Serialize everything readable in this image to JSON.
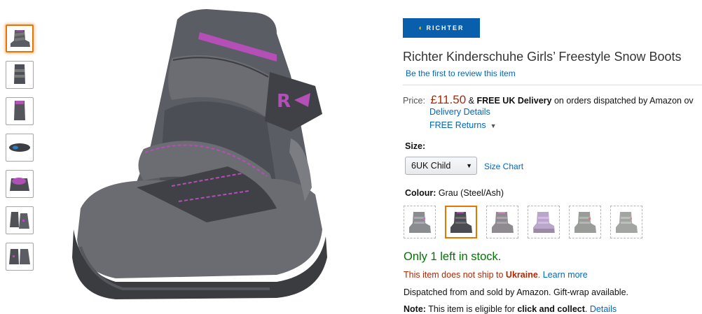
{
  "brand": {
    "logo_text": "RICHTER"
  },
  "product": {
    "title": "Richter Kinderschuhe Girls’ Freestyle Snow Boots",
    "review_link": "Be the first to review this item"
  },
  "pricing": {
    "label": "Price:",
    "price": "£11.50",
    "amp": "&",
    "free_delivery": "FREE UK Delivery",
    "delivery_suffix": "on orders dispatched by Amazon ov",
    "delivery_details_link": "Delivery Details",
    "free_returns_link": "FREE Returns"
  },
  "size": {
    "label": "Size:",
    "selected": "6UK Child",
    "chart_link": "Size Chart"
  },
  "colour": {
    "label": "Colour:",
    "selected": "Grau (Steel/Ash)",
    "selected_index": 1,
    "count": 6
  },
  "stock": {
    "text": "Only 1 left in stock."
  },
  "shipping": {
    "prefix": "This item does not ship to",
    "country": "Ukraine",
    "period": ".",
    "learn_more": "Learn more"
  },
  "dispatch": {
    "text": "Dispatched from and sold by Amazon. Gift-wrap available."
  },
  "note": {
    "label": "Note:",
    "text": "This item is eligible for",
    "bold": "click and collect",
    "link": "Details"
  },
  "thumbnails": {
    "count": 7,
    "selected_index": 0
  },
  "colors": {
    "price": "#b12704",
    "link": "#0066c0",
    "stock": "#007600",
    "accent": "#e77600",
    "brand_bg": "#0a5fad"
  }
}
